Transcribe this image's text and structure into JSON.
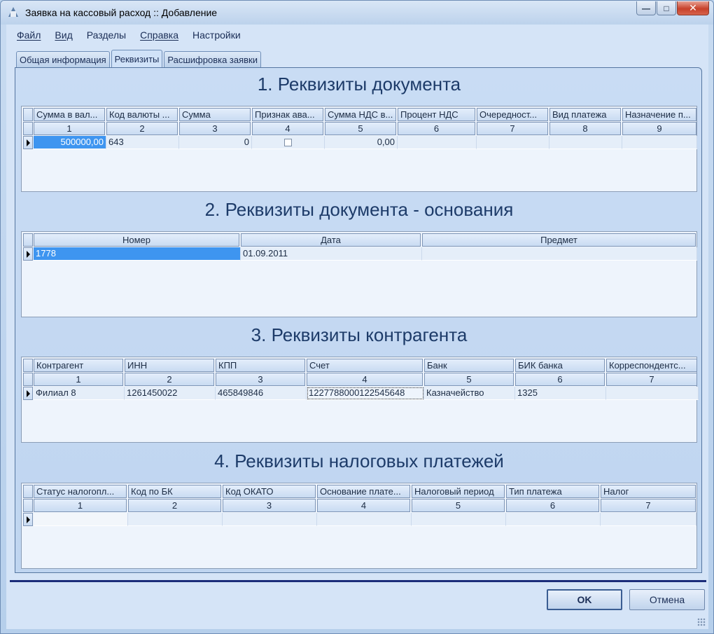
{
  "window": {
    "title": "Заявка на кассовый расход :: Добавление"
  },
  "menu": [
    "Файл",
    "Вид",
    "Разделы",
    "Справка",
    "Настройки"
  ],
  "tabs": [
    "Общая информация",
    "Реквизиты",
    "Расшифровка заявки"
  ],
  "sections": {
    "s1": {
      "title": "1. Реквизиты документа",
      "headers": [
        "Сумма в вал...",
        "Код валюты ...",
        "Сумма",
        "Признак ава...",
        "Сумма НДС в...",
        "Процент НДС",
        "Очередност...",
        "Вид платежа",
        "Назначение п..."
      ],
      "numbers": [
        "1",
        "2",
        "3",
        "4",
        "5",
        "6",
        "7",
        "8",
        "9"
      ],
      "row": [
        "500000,00",
        "643",
        "0",
        "",
        "0,00",
        "",
        "",
        "",
        ""
      ]
    },
    "s2": {
      "title": "2. Реквизиты документа - основания",
      "headers": [
        "Номер",
        "Дата",
        "Предмет"
      ],
      "row": [
        "1778",
        "01.09.2011",
        ""
      ]
    },
    "s3": {
      "title": "3. Реквизиты контрагента",
      "headers": [
        "Контрагент",
        "ИНН",
        "КПП",
        "Счет",
        "Банк",
        "БИК банка",
        "Корреспондентс..."
      ],
      "numbers": [
        "1",
        "2",
        "3",
        "4",
        "5",
        "6",
        "7"
      ],
      "row": [
        "Филиал 8",
        "1261450022",
        "465849846",
        "1227788000122545648",
        "Казначейство",
        "1325",
        ""
      ]
    },
    "s4": {
      "title": "4. Реквизиты налоговых платежей",
      "headers": [
        "Статус налогопл...",
        "Код по БК",
        "Код ОКАТО",
        "Основание плате...",
        "Налоговый период",
        "Тип платежа",
        "Налог"
      ],
      "numbers": [
        "1",
        "2",
        "3",
        "4",
        "5",
        "6",
        "7"
      ],
      "row": [
        "",
        "",
        "",
        "",
        "",
        "",
        ""
      ]
    }
  },
  "buttons": {
    "ok": "OK",
    "cancel": "Отмена"
  },
  "colors": {
    "selection": "#3e95f0",
    "title_text": "#1d3b69",
    "separator": "#1b2d7a"
  }
}
